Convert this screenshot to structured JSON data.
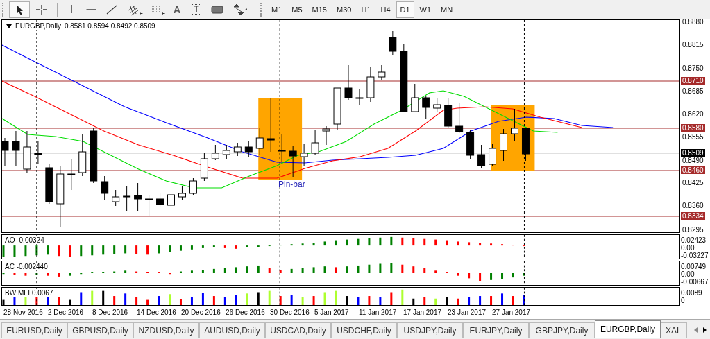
{
  "toolbar": {
    "tools": [
      {
        "kind": "cursor",
        "selected": true
      },
      {
        "kind": "crosshair",
        "selected": false
      },
      {
        "kind": "vline",
        "selected": false
      },
      {
        "kind": "hline",
        "selected": false
      },
      {
        "kind": "trendline",
        "selected": false
      },
      {
        "kind": "fibo-channel",
        "letter": "E",
        "selected": false
      },
      {
        "kind": "fibo-lines",
        "letter": "F",
        "selected": false
      },
      {
        "kind": "text",
        "letter": "A",
        "selected": false
      },
      {
        "kind": "label",
        "letter": "T",
        "selected": false
      },
      {
        "kind": "rectangle",
        "selected": false
      },
      {
        "kind": "arrows",
        "selected": false
      }
    ],
    "timeframes": [
      {
        "label": "M1",
        "selected": false
      },
      {
        "label": "M5",
        "selected": false
      },
      {
        "label": "M15",
        "selected": false
      },
      {
        "label": "M30",
        "selected": false
      },
      {
        "label": "H1",
        "selected": false
      },
      {
        "label": "H4",
        "selected": false
      },
      {
        "label": "D1",
        "selected": true
      },
      {
        "label": "W1",
        "selected": false
      },
      {
        "label": "MN",
        "selected": false
      }
    ]
  },
  "chart": {
    "symbol": "EURGBP,Daily",
    "prices": "0.8581 0.8594 0.8492 0.8509",
    "annotation": "Pin-bar",
    "price_axis": [
      {
        "label": "0.8880",
        "kind": "tick"
      },
      {
        "label": "0.8815",
        "kind": "tick"
      },
      {
        "label": "0.8750",
        "kind": "tick"
      },
      {
        "label": "0.8710",
        "kind": "level"
      },
      {
        "label": "0.8685",
        "kind": "tick"
      },
      {
        "label": "0.8620",
        "kind": "tick"
      },
      {
        "label": "0.8580",
        "kind": "level"
      },
      {
        "label": "0.8555",
        "kind": "tick"
      },
      {
        "label": "0.8509",
        "kind": "current"
      },
      {
        "label": "0.8490",
        "kind": "tick"
      },
      {
        "label": "0.8460",
        "kind": "level"
      },
      {
        "label": "0.8425",
        "kind": "tick"
      },
      {
        "label": "0.8360",
        "kind": "tick"
      },
      {
        "label": "0.8334",
        "kind": "level"
      },
      {
        "label": "0.8295",
        "kind": "tick"
      }
    ],
    "indicators": [
      {
        "label": "AO -0.00324",
        "scale": [
          "0.02423",
          "0.00",
          "-0.03227"
        ]
      },
      {
        "label": "AC -0.002440",
        "scale": [
          "0.00749",
          "0.00",
          "-0.00667"
        ]
      },
      {
        "label": "BW MFI 0.0067",
        "scale": [
          "0.0089",
          "0"
        ]
      }
    ],
    "dates": [
      "28 Nov 2016",
      "2 Dec 2016",
      "8 Dec 2016",
      "14 Dec 2016",
      "20 Dec 2016",
      "26 Dec 2016",
      "30 Dec 2016",
      "5 Jan 2017",
      "11 Jan 2017",
      "17 Jan 2017",
      "23 Jan 2017",
      "27 Jan 2017"
    ]
  },
  "tabs": [
    {
      "label": "EURUSD,Daily",
      "selected": false
    },
    {
      "label": "GBPUSD,Daily",
      "selected": false
    },
    {
      "label": "NZDUSD,Daily",
      "selected": false
    },
    {
      "label": "AUDUSD,Daily",
      "selected": false
    },
    {
      "label": "USDCAD,Daily",
      "selected": false
    },
    {
      "label": "USDCHF,Daily",
      "selected": false
    },
    {
      "label": "USDJPY,Daily",
      "selected": false
    },
    {
      "label": "EURJPY,Daily",
      "selected": false
    },
    {
      "label": "GBPJPY,Daily",
      "selected": false
    },
    {
      "label": "EURGBP,Daily",
      "selected": true
    },
    {
      "label": "XAL",
      "selected": false
    }
  ]
}
